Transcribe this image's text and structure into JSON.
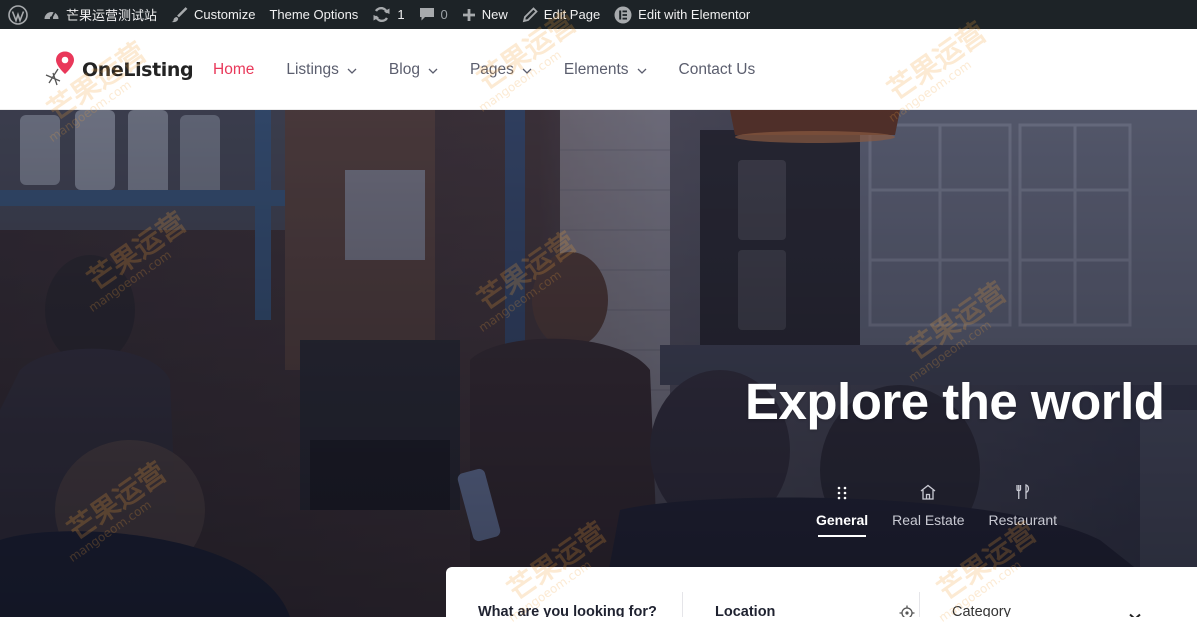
{
  "admin_bar": {
    "site_name": "芒果运营测试站",
    "customize": "Customize",
    "theme_options": "Theme Options",
    "updates_count": "1",
    "comments_count": "0",
    "new": "New",
    "edit_page": "Edit Page",
    "edit_elementor": "Edit with Elementor",
    "colors": {
      "bg": "#1d2327",
      "text": "#f0f0f1"
    }
  },
  "header": {
    "logo_text": "OneListing",
    "nav": [
      {
        "label": "Home",
        "active": true,
        "dropdown": false
      },
      {
        "label": "Listings",
        "active": false,
        "dropdown": true
      },
      {
        "label": "Blog",
        "active": false,
        "dropdown": true
      },
      {
        "label": "Pages",
        "active": false,
        "dropdown": true
      },
      {
        "label": "Elements",
        "active": false,
        "dropdown": true
      },
      {
        "label": "Contact Us",
        "active": false,
        "dropdown": false
      }
    ],
    "accent_color": "#e9385a"
  },
  "hero": {
    "title": "Explore the world",
    "tabs": [
      {
        "label": "General",
        "icon": "grid-dots-icon",
        "active": true
      },
      {
        "label": "Real Estate",
        "icon": "home-icon",
        "active": false
      },
      {
        "label": "Restaurant",
        "icon": "fork-knife-icon",
        "active": false
      }
    ]
  },
  "search": {
    "keyword_label": "What are you looking for?",
    "location_label": "Location",
    "category_placeholder": "Category"
  },
  "watermark": {
    "text": "芒果运营",
    "sub": "mangoeom.com"
  }
}
